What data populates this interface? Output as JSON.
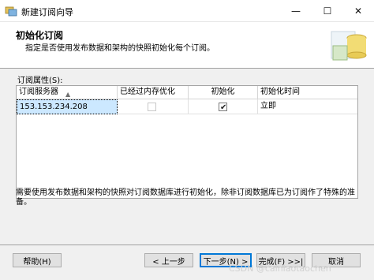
{
  "window": {
    "title": "新建订阅向导",
    "controls": {
      "minimize": "—",
      "maximize": "☐",
      "close": "✕"
    }
  },
  "header": {
    "title": "初始化订阅",
    "description": "指定是否使用发布数据和架构的快照初始化每个订阅。"
  },
  "grid": {
    "label": "订阅属性(S):",
    "columns": [
      "订阅服务器",
      "已经过内存优化",
      "初始化",
      "初始化时间"
    ],
    "rows": [
      {
        "server": "153.153.234.208",
        "memory_optimized": false,
        "initialize": true,
        "init_time": "立即"
      }
    ]
  },
  "note": "需要使用发布数据和架构的快照对订阅数据库进行初始化，除非订阅数据库已为订阅作了特殊的准备。",
  "buttons": {
    "help": "帮助(H)",
    "back": "< 上一步",
    "next": "下一步(N) >",
    "finish": "完成(F) >>|",
    "cancel": "取消"
  },
  "watermark": "CSDN @cainiaotaochen",
  "colors": {
    "selection": "#cce8ff",
    "accent": "#0078d7",
    "panel": "#f0f0f0"
  }
}
